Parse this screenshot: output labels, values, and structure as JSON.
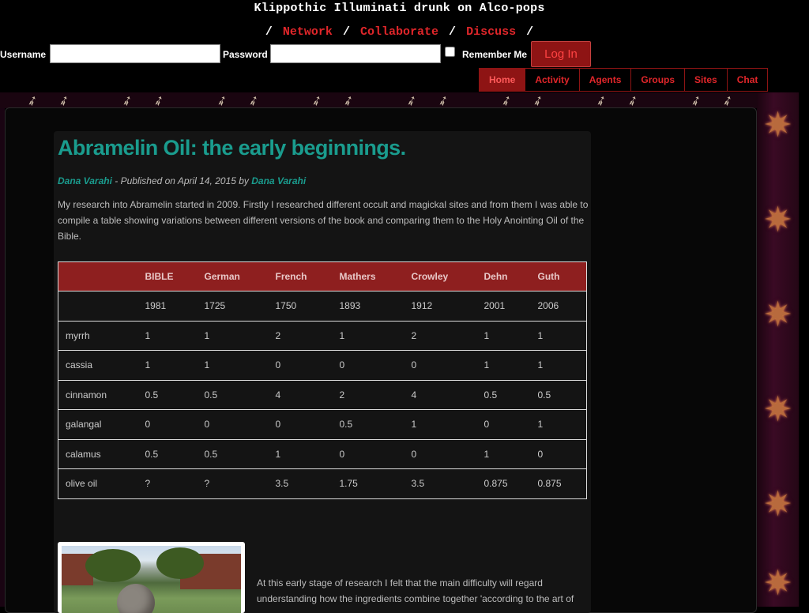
{
  "site": {
    "title": "Klippothic Illuminati drunk on Alco-pops",
    "nav_links": [
      "Network",
      "Collaborate",
      "Discuss"
    ]
  },
  "login": {
    "username_label": "Username",
    "username_value": "",
    "password_label": "Password",
    "password_value": "",
    "remember_label": "Remember Me",
    "remember_checked": false,
    "button_label": "Log In"
  },
  "tabs": [
    {
      "label": "Home",
      "active": true
    },
    {
      "label": "Activity",
      "active": false
    },
    {
      "label": "Agents",
      "active": false
    },
    {
      "label": "Groups",
      "active": false
    },
    {
      "label": "Sites",
      "active": false
    },
    {
      "label": "Chat",
      "active": false
    }
  ],
  "article": {
    "title": "Abramelin Oil: the early beginnings.",
    "author": "Dana Varahi",
    "published_text": " - Published on April 14, 2015 by ",
    "publisher": "Dana Varahi",
    "intro": "My research into Abramelin started in 2009. Firstly I researched different occult and magickal sites and from them I was able to compile a table showing variations between different versions of the book and comparing them to the Holy Anointing Oil of the Bible.",
    "followup": "At this early stage of research I felt that the main difficulty will regard understanding how the ingredients combine together 'according to the art of"
  },
  "table": {
    "headers": [
      "",
      "BIBLE",
      "German",
      "French",
      "Mathers",
      "Crowley",
      "Dehn",
      "Guth"
    ],
    "rows": [
      [
        "",
        "1981",
        "1725",
        "1750",
        "1893",
        "1912",
        "2001",
        "2006"
      ],
      [
        "myrrh",
        "1",
        "1",
        "2",
        "1",
        "2",
        "1",
        "1"
      ],
      [
        "cassia",
        "1",
        "1",
        "0",
        "0",
        "0",
        "1",
        "1"
      ],
      [
        "cinnamon",
        "0.5",
        "0.5",
        "4",
        "2",
        "4",
        "0.5",
        "0.5"
      ],
      [
        "galangal",
        "0",
        "0",
        "0",
        "0.5",
        "1",
        "0",
        "1"
      ],
      [
        "calamus",
        "0.5",
        "0.5",
        "1",
        "0",
        "0",
        "1",
        "0"
      ],
      [
        "olive oil",
        "?",
        "?",
        "3.5",
        "1.75",
        "3.5",
        "0.875",
        "0.875"
      ]
    ]
  },
  "colors": {
    "accent_red": "#e0262a",
    "tab_active_bg": "#8e1414",
    "title_teal": "#1a9c8e",
    "table_header_bg": "#8e1f1f"
  },
  "icons": {
    "banner": "sigil-arrow-icon",
    "side": "chaos-star-icon"
  }
}
